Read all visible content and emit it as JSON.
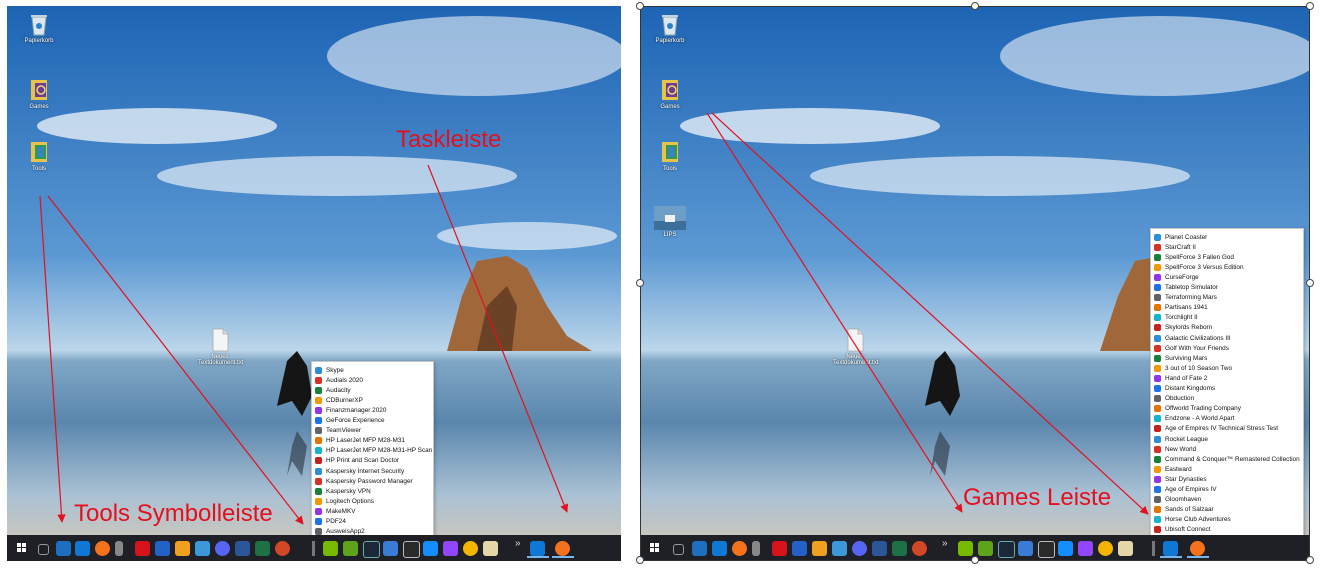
{
  "left_panel": {
    "desktop_icons": [
      {
        "label": "Papierkorb",
        "icon": "recycle-bin-icon"
      },
      {
        "label": "Games",
        "icon": "games-folder-icon"
      },
      {
        "label": "Tools",
        "icon": "tools-folder-icon"
      }
    ],
    "file_icon": {
      "line1": "Neues",
      "line2": "Textdokument.txt",
      "icon": "text-file-icon"
    },
    "annotations": {
      "taskleiste": "Taskleiste",
      "tools": "Tools Symbolleiste"
    },
    "tools_menu": [
      "Skype",
      "Audials 2020",
      "Audacity",
      "CDBurnerXP",
      "Finanzmanager 2020",
      "GeForce Experience",
      "TeamViewer",
      "HP LaserJet MFP M28-M31",
      "HP LaserJet MFP M28-M31-HP Scan",
      "HP Print and Scan Doctor",
      "Kaspersky Internet Security",
      "Kaspersky Password Manager",
      "Kaspersky VPN",
      "Logitech Options",
      "MakeMKV",
      "PDF24",
      "AusweisApp2"
    ]
  },
  "right_panel": {
    "desktop_icons": [
      {
        "label": "Papierkorb",
        "icon": "recycle-bin-icon"
      },
      {
        "label": "Games",
        "icon": "games-folder-icon"
      },
      {
        "label": "Tools",
        "icon": "tools-folder-icon"
      },
      {
        "label": "LIPS",
        "icon": "lips-image-icon"
      }
    ],
    "file_icon": {
      "line1": "Neues",
      "line2": "Textdokument.txt",
      "icon": "text-file-icon"
    },
    "annotations": {
      "games": "Games Leiste"
    },
    "games_menu": [
      "Planet Coaster",
      "StarCraft II",
      "SpellForce 3 Fallen God",
      "SpellForce 3 Versus Edition",
      "CurseForge",
      "Tabletop Simulator",
      "Terraforming Mars",
      "Partisans 1941",
      "Torchlight II",
      "Skylords Reborn",
      "Galactic Civilizations III",
      "Golf With Your Friends",
      "Surviving Mars",
      "3 out of 10 Season Two",
      "Hand of Fate 2",
      "Distant Kingdoms",
      "Obduction",
      "Offworld Trading Company",
      "Endzone - A World Apart",
      "Age of Empires IV Technical Stress Test",
      "Rocket League",
      "New World",
      "Command & Conquer™ Remastered Collection",
      "Eastward",
      "Star Dynasties",
      "Age of Empires IV",
      "Gloomhaven",
      "Sands of Salzaar",
      "Horse Club Adventures",
      "Ubisoft Connect"
    ]
  },
  "taskbar": {
    "chevron": "»",
    "pinned_icons": [
      "search-icon",
      "task-view-icon",
      "sharepoint-icon",
      "outlook-icon",
      "firefox-icon",
      "app-icon",
      "netflix-icon",
      "sky-icon",
      "vivaldi-icon",
      "ssd-icon",
      "discord-icon",
      "word-icon",
      "excel-icon",
      "powerpoint-icon"
    ],
    "tools_toolbar_icons": [
      "nvidia-icon",
      "geforce-icon",
      "steam-icon",
      "tool-icon",
      "epic-games-icon",
      "battle-net-icon",
      "twitch-icon",
      "ubisoft-icon",
      "photo-icon"
    ],
    "running_icons": [
      "outlook-icon",
      "firefox-icon"
    ]
  },
  "colors": {
    "annotation": "#e3101f",
    "taskbar": "#1f1f26",
    "sky_top": "#1d64b4",
    "sea": "#6d9cc2"
  }
}
